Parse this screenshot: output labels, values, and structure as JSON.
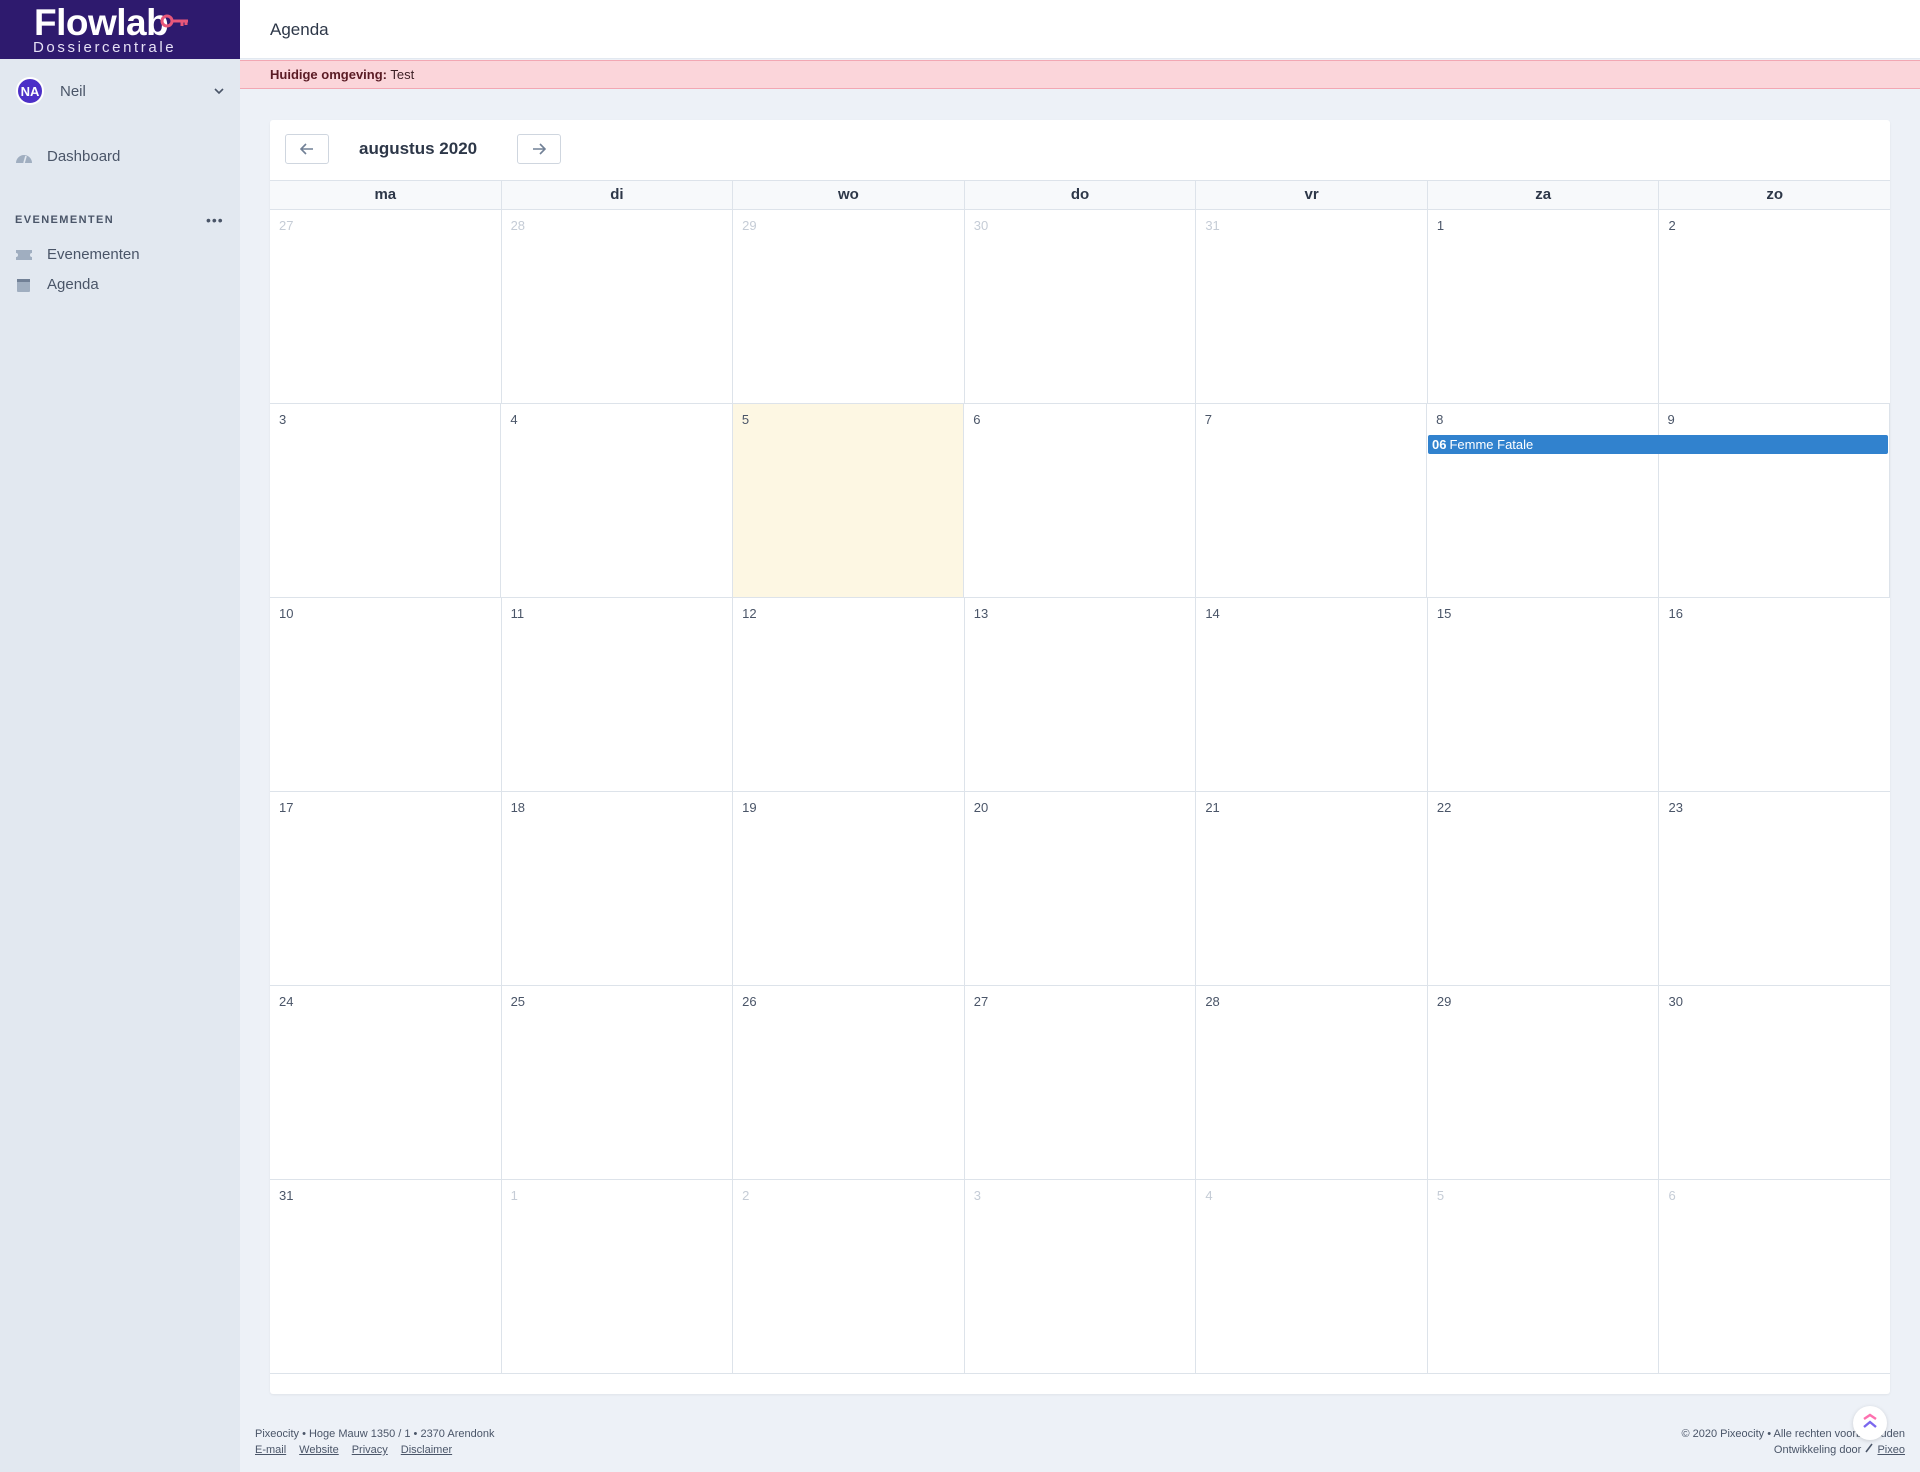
{
  "brand": {
    "name": "Flowlab",
    "subtitle": "Dossiercentrale"
  },
  "user": {
    "initials": "NA",
    "name": "Neil"
  },
  "nav": {
    "dashboard": "Dashboard",
    "section_title": "EVENEMENTEN",
    "section_more": "•••",
    "evenementen": "Evenementen",
    "agenda": "Agenda"
  },
  "header": {
    "title": "Agenda"
  },
  "environment": {
    "label": "Huidige omgeving:",
    "value": "Test"
  },
  "calendar": {
    "month_title": "augustus 2020",
    "weekdays": [
      "ma",
      "di",
      "wo",
      "do",
      "vr",
      "za",
      "zo"
    ],
    "weeks": [
      [
        "27",
        "28",
        "29",
        "30",
        "31",
        "1",
        "2"
      ],
      [
        "3",
        "4",
        "5",
        "6",
        "7",
        "8",
        "9"
      ],
      [
        "10",
        "11",
        "12",
        "13",
        "14",
        "15",
        "16"
      ],
      [
        "17",
        "18",
        "19",
        "20",
        "21",
        "22",
        "23"
      ],
      [
        "24",
        "25",
        "26",
        "27",
        "28",
        "29",
        "30"
      ],
      [
        "31",
        "1",
        "2",
        "3",
        "4",
        "5",
        "6"
      ]
    ],
    "event": {
      "time": "06",
      "title": "Femme Fatale"
    }
  },
  "footer": {
    "address": "Pixeocity • Hoge Mauw 1350 / 1 • 2370 Arendonk",
    "links": [
      "E-mail",
      "Website",
      "Privacy",
      "Disclaimer"
    ],
    "copyright": "© 2020 Pixeocity • Alle rechten voorbehouden",
    "dev_label": "Ontwikkeling door",
    "dev_link": "Pixeo"
  },
  "colors": {
    "brand": "#2e1a6e",
    "event": "#3182ce",
    "today": "#fdf7e3",
    "banner": "#fbd5da"
  }
}
